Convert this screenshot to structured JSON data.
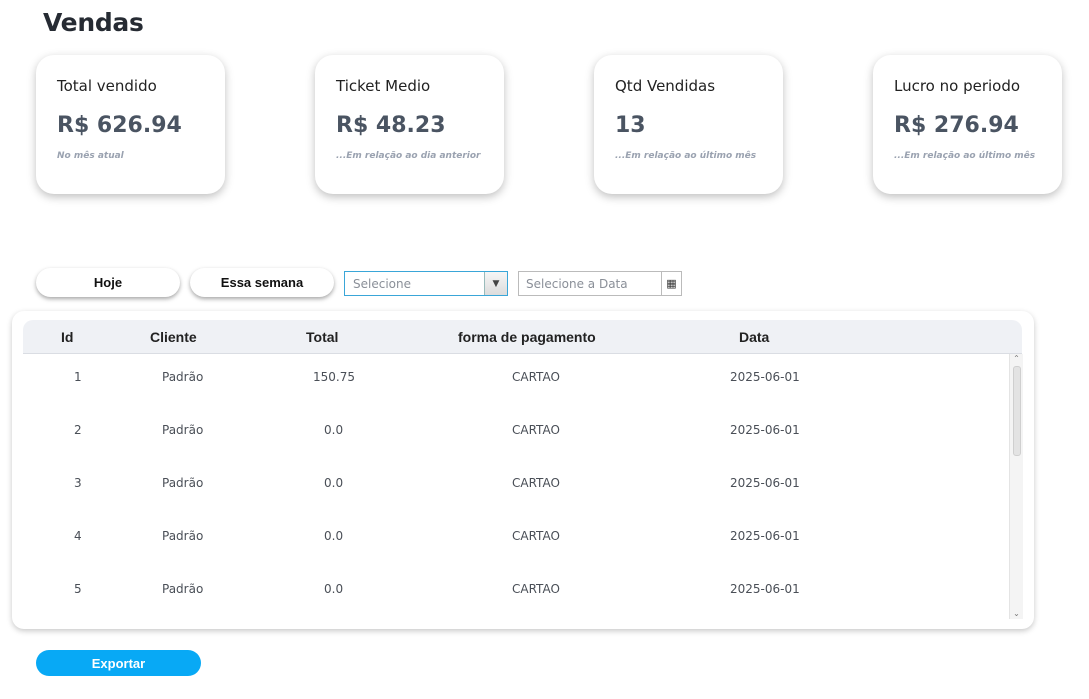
{
  "page": {
    "title": "Vendas"
  },
  "cards": [
    {
      "title": "Total vendido",
      "value": "R$ 626.94",
      "note": "No mês atual"
    },
    {
      "title": "Ticket Medio",
      "value": "R$ 48.23",
      "note": "...Em relação ao dia anterior"
    },
    {
      "title": "Qtd Vendidas",
      "value": "13",
      "note": "...Em relação ao último mês"
    },
    {
      "title": "Lucro no periodo",
      "value": "R$ 276.94",
      "note": "...Em relação ao último mês"
    }
  ],
  "filters": {
    "today_label": "Hoje",
    "week_label": "Essa semana",
    "select_placeholder": "Selecione",
    "date_placeholder": "Selecione a Data"
  },
  "table": {
    "headers": {
      "id": "Id",
      "cliente": "Cliente",
      "total": "Total",
      "pagamento": "forma de pagamento",
      "data": "Data"
    },
    "rows": [
      {
        "id": "1",
        "cliente": "Padrão",
        "total": "150.75",
        "pagamento": "CARTAO",
        "data": "2025-06-01"
      },
      {
        "id": "2",
        "cliente": "Padrão",
        "total": "0.0",
        "pagamento": "CARTAO",
        "data": "2025-06-01"
      },
      {
        "id": "3",
        "cliente": "Padrão",
        "total": "0.0",
        "pagamento": "CARTAO",
        "data": "2025-06-01"
      },
      {
        "id": "4",
        "cliente": "Padrão",
        "total": "0.0",
        "pagamento": "CARTAO",
        "data": "2025-06-01"
      },
      {
        "id": "5",
        "cliente": "Padrão",
        "total": "0.0",
        "pagamento": "CARTAO",
        "data": "2025-06-01"
      }
    ]
  },
  "actions": {
    "export_label": "Exportar"
  },
  "icons": {
    "combo_arrow": "chevron-down-icon",
    "calendar": "calendar-icon"
  },
  "colors": {
    "accent": "#08a9f5",
    "combo_border": "#3aa6d8",
    "value_text": "#4a5462"
  }
}
